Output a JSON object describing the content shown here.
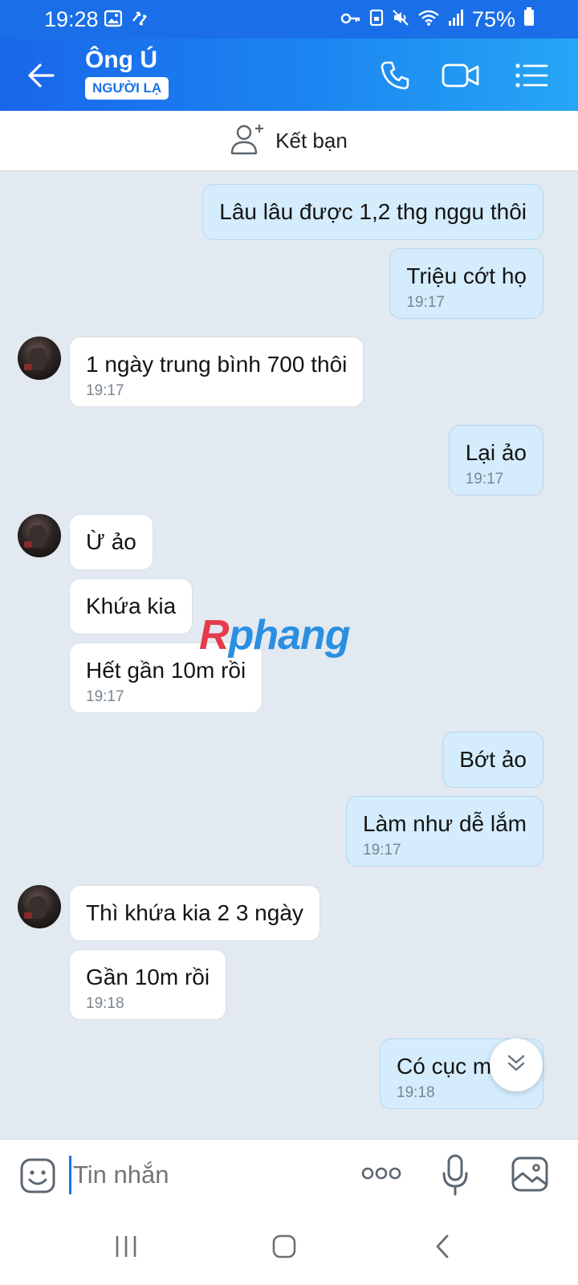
{
  "status_bar": {
    "time": "19:28",
    "battery": "75%",
    "icons": [
      "gallery-icon",
      "transfer-icon",
      "key-icon",
      "lock-file-icon",
      "mute-icon",
      "wifi-icon",
      "signal-icon",
      "battery-icon"
    ]
  },
  "header": {
    "contact_name": "Ông Ú",
    "badge": "NGƯỜI LẠ",
    "icons": [
      "back-arrow-icon",
      "phone-icon",
      "video-call-icon",
      "menu-list-icon"
    ]
  },
  "friend_bar": {
    "label": "Kết bạn",
    "icon": "add-friend-icon"
  },
  "messages": [
    {
      "dir": "out",
      "text": "Lâu lâu được 1,2 thg nggu thôi",
      "time": ""
    },
    {
      "dir": "out",
      "text": "Triệu cớt họ",
      "time": "19:17"
    },
    {
      "dir": "in",
      "text": "1 ngày trung bình 700 thôi",
      "time": "19:17"
    },
    {
      "dir": "out",
      "text": "Lại ảo",
      "time": "19:17"
    },
    {
      "dir": "in",
      "text": "Ừ ảo",
      "time": ""
    },
    {
      "dir": "in",
      "text": "Khứa kia",
      "time": ""
    },
    {
      "dir": "in",
      "text": "Hết gần 10m rồi",
      "time": "19:17"
    },
    {
      "dir": "out",
      "text": "Bớt ảo",
      "time": ""
    },
    {
      "dir": "out",
      "text": "Làm như dễ lắm",
      "time": "19:17"
    },
    {
      "dir": "in",
      "text": "Thì khứa kia 2 3 ngày",
      "time": ""
    },
    {
      "dir": "in",
      "text": "Gần 10m rồi",
      "time": "19:18"
    },
    {
      "dir": "out",
      "text": "Có cục m",
      "time": "19:18"
    }
  ],
  "watermark": {
    "first": "R",
    "rest": "phang"
  },
  "input_bar": {
    "placeholder": "Tin nhắn",
    "icons": [
      "sticker-icon",
      "more-dots-icon",
      "microphone-icon",
      "image-icon"
    ]
  },
  "nav_bar": {
    "icons": [
      "recent-apps-icon",
      "home-icon",
      "back-icon"
    ]
  },
  "colors": {
    "header_start": "#1a66ea",
    "header_end": "#26a6f5",
    "outgoing_bubble": "#d4ecfc",
    "incoming_bubble": "#ffffff",
    "chat_background": "#e2e9f1"
  }
}
